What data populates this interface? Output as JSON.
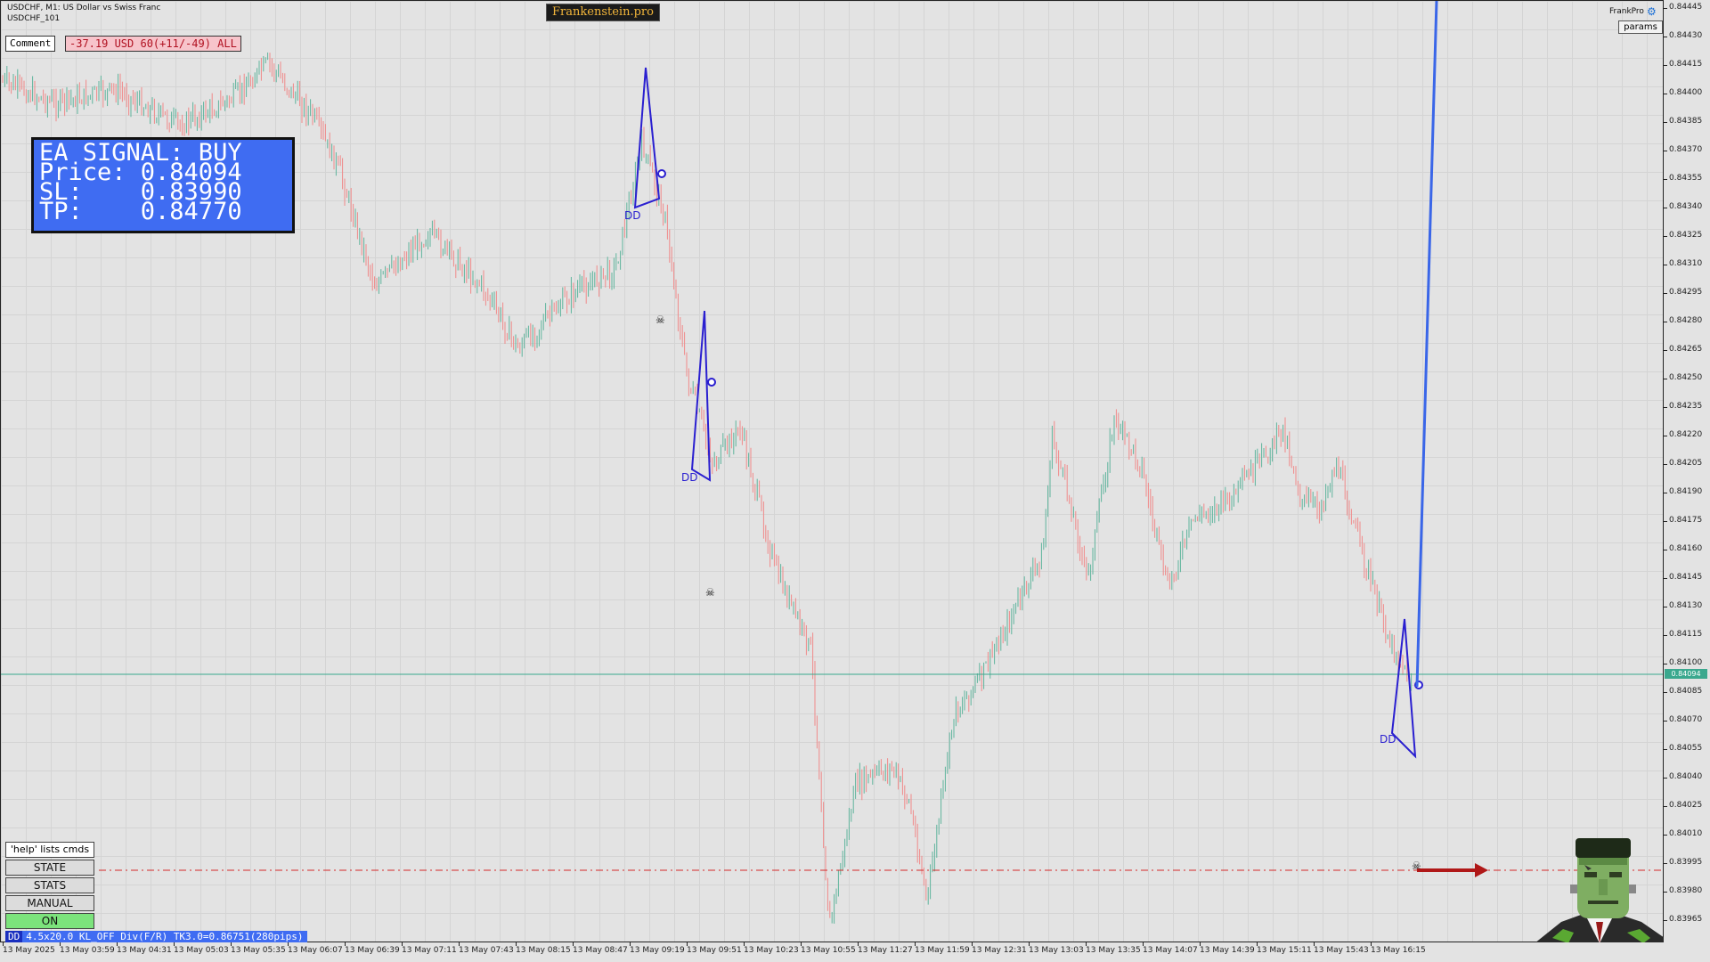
{
  "header": {
    "symbol_line": "USDCHF, M1:  US Dollar vs Swiss Franc",
    "ea_name": "USDCHF_101",
    "brand": "Frankenstein.pro",
    "account_name": "FrankPro",
    "params_label": "params"
  },
  "comment": {
    "label": "Comment",
    "pl_text": "-37.19 USD 60(+11/-49) ALL"
  },
  "signal": {
    "line1": "EA SIGNAL: BUY",
    "line2": "Price: 0.84094",
    "line3": "SL:    0.83990",
    "line4": "TP:    0.84770"
  },
  "controls": {
    "help": "'help' lists cmds",
    "state": "STATE",
    "stats": "STATS",
    "manual": "MANUAL",
    "on": "ON"
  },
  "status": {
    "dd": "DD",
    "text": "4.5x20.0 KL_OFF Div(F/R) TK3.0=0.86751(280pips)"
  },
  "markers": {
    "dd_label": "DD"
  },
  "current_price_label": "0.84094",
  "price_axis": [
    "0.84445",
    "0.84430",
    "0.84415",
    "0.84400",
    "0.84385",
    "0.84370",
    "0.84355",
    "0.84340",
    "0.84325",
    "0.84310",
    "0.84295",
    "0.84280",
    "0.84265",
    "0.84250",
    "0.84235",
    "0.84220",
    "0.84205",
    "0.84190",
    "0.84175",
    "0.84160",
    "0.84145",
    "0.84130",
    "0.84115",
    "0.84100",
    "0.84085",
    "0.84070",
    "0.84055",
    "0.84040",
    "0.84025",
    "0.84010",
    "0.83995",
    "0.83980",
    "0.83965"
  ],
  "time_axis": [
    "13 May 2025",
    "13 May 03:59",
    "13 May 04:31",
    "13 May 05:03",
    "13 May 05:35",
    "13 May 06:07",
    "13 May 06:39",
    "13 May 07:11",
    "13 May 07:43",
    "13 May 08:15",
    "13 May 08:47",
    "13 May 09:19",
    "13 May 09:51",
    "13 May 10:23",
    "13 May 10:55",
    "13 May 11:27",
    "13 May 11:59",
    "13 May 12:31",
    "13 May 13:03",
    "13 May 13:35",
    "13 May 14:07",
    "13 May 14:39",
    "13 May 15:11",
    "13 May 15:43",
    "13 May 16:15"
  ],
  "colors": {
    "bull": "#5fb49c",
    "bear": "#f08a8a",
    "signal_bg": "#3f6cf2",
    "dd_line": "#2a1fd0",
    "tp_line": "#3a66e8",
    "sl_line": "#d52a2a"
  },
  "icons": [
    "skull-icon",
    "gear-icon",
    "frankenstein-avatar-icon",
    "arrow-right-icon"
  ]
}
